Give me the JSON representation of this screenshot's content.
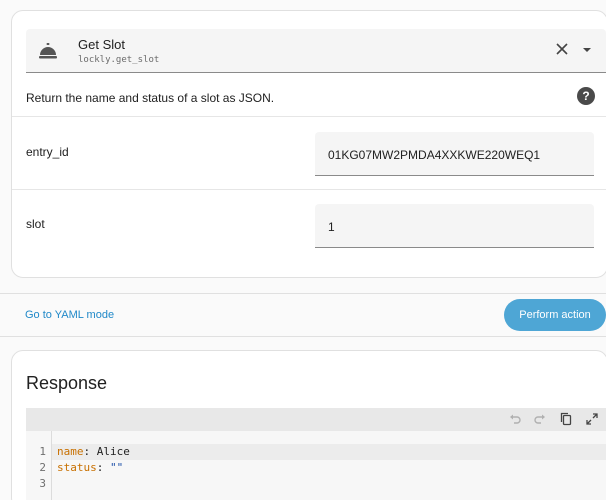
{
  "action": {
    "title": "Get Slot",
    "service_id": "lockly.get_slot",
    "description": "Return the name and status of a slot as JSON.",
    "help_glyph": "?"
  },
  "fields": [
    {
      "label": "entry_id",
      "value": "01KG07MW2PMDA4XXKWE220WEQ1"
    },
    {
      "label": "slot",
      "value": "1"
    }
  ],
  "footer": {
    "yaml_link": "Go to YAML mode",
    "perform_button": "Perform action",
    "button_color": "#4ea6d5",
    "link_color": "#1f88c8"
  },
  "response": {
    "title": "Response",
    "line_numbers": [
      "1",
      "2",
      "3"
    ],
    "lines": [
      {
        "key": "name",
        "sep": ": ",
        "value": "Alice",
        "value_type": "plain"
      },
      {
        "key": "status",
        "sep": ": ",
        "value": "\"\"",
        "value_type": "string"
      },
      {
        "key": "",
        "sep": "",
        "value": "",
        "value_type": "plain"
      }
    ],
    "toolbar_icons": [
      "undo-icon",
      "redo-icon",
      "copy-icon",
      "fullscreen-icon"
    ]
  }
}
